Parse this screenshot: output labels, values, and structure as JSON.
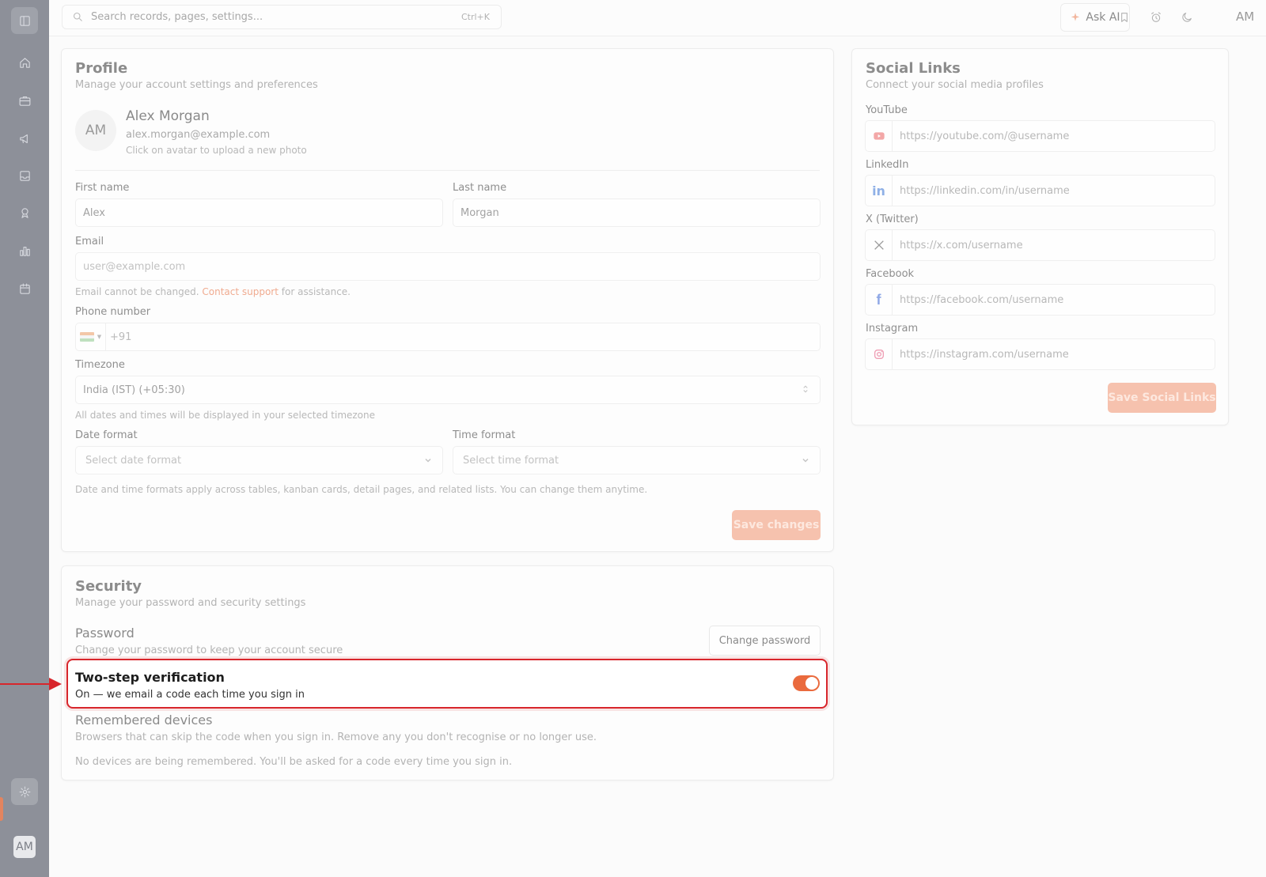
{
  "topbar": {
    "search_placeholder": "Search records, pages, settings...",
    "search_shortcut": "Ctrl+K",
    "ask_ai_label": "Ask AI",
    "avatar_initials": "AM"
  },
  "sidebar": {
    "avatar_initials": "AM",
    "items": [
      "sidebar-toggle",
      "home",
      "briefcase",
      "megaphone",
      "inbox",
      "award",
      "chart",
      "calendar",
      "settings"
    ]
  },
  "profile": {
    "title": "Profile",
    "subtitle": "Manage your account settings and preferences",
    "avatar_initials": "AM",
    "name": "Alex Morgan",
    "email": "alex.morgan@example.com",
    "avatar_hint": "Click on avatar to upload a new photo",
    "first_name_label": "First name",
    "first_name_value": "Alex",
    "last_name_label": "Last name",
    "last_name_value": "Morgan",
    "email_label": "Email",
    "email_placeholder": "user@example.com",
    "email_help_prefix": "Email cannot be changed.",
    "email_help_link": "Contact support",
    "email_help_suffix": "for assistance.",
    "phone_label": "Phone number",
    "phone_code": "+91",
    "timezone_label": "Timezone",
    "timezone_value": "India (IST) (+05:30)",
    "timezone_help": "All dates and times will be displayed in your selected timezone",
    "date_format_label": "Date format",
    "date_format_placeholder": "Select date format",
    "time_format_label": "Time format",
    "time_format_placeholder": "Select time format",
    "format_help": "Date and time formats apply across tables, kanban cards, detail pages, and related lists. You can change them anytime.",
    "save_label": "Save changes"
  },
  "security": {
    "title": "Security",
    "subtitle": "Manage your password and security settings",
    "password_title": "Password",
    "password_sub": "Change your password to keep your account secure",
    "change_password_label": "Change password",
    "two_step_title": "Two-step verification",
    "two_step_sub": "On — we email a code each time you sign in",
    "two_step_enabled": true,
    "devices_title": "Remembered devices",
    "devices_sub": "Browsers that can skip the code when you sign in. Remove any you don't recognise or no longer use.",
    "devices_empty": "No devices are being remembered. You'll be asked for a code every time you sign in."
  },
  "social": {
    "title": "Social Links",
    "subtitle": "Connect your social media profiles",
    "youtube_label": "YouTube",
    "youtube_placeholder": "https://youtube.com/@username",
    "linkedin_label": "LinkedIn",
    "linkedin_placeholder": "https://linkedin.com/in/username",
    "x_label": "X (Twitter)",
    "x_placeholder": "https://x.com/username",
    "facebook_label": "Facebook",
    "facebook_placeholder": "https://facebook.com/username",
    "instagram_label": "Instagram",
    "instagram_placeholder": "https://instagram.com/username",
    "save_label": "Save Social Links"
  },
  "colors": {
    "accent": "#ea6a3d",
    "highlight": "#d8262c",
    "sidebar": "#8d9099"
  }
}
